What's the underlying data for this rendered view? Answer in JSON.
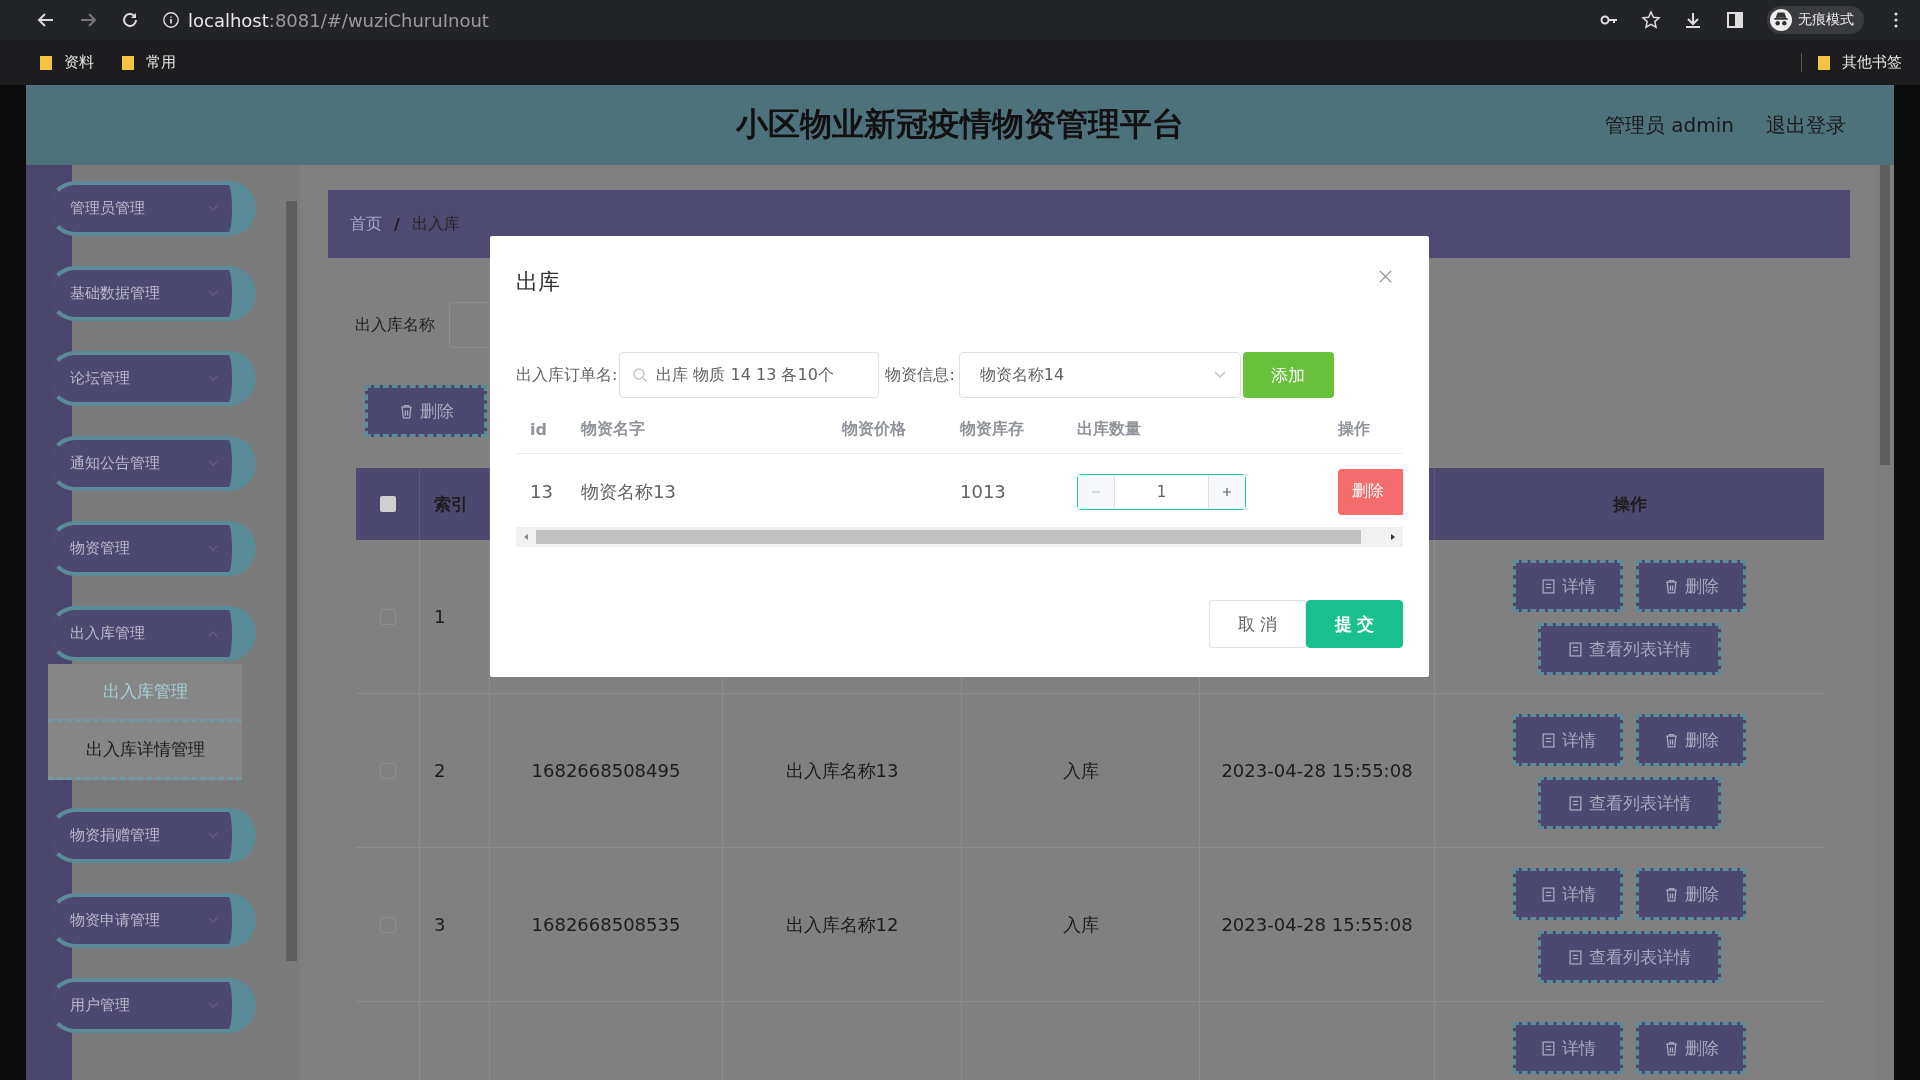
{
  "browser": {
    "url_host": "localhost",
    "url_path": ":8081/#/wuziChuruInout",
    "profile": "无痕模式",
    "bookmarks": [
      {
        "label": "资料"
      },
      {
        "label": "常用"
      }
    ],
    "other_bookmarks": "其他书签"
  },
  "header": {
    "title": "小区物业新冠疫情物资管理平台",
    "user": "管理员 admin",
    "logout": "退出登录"
  },
  "sidebar": {
    "items": [
      {
        "label": "管理员管理",
        "expanded": false
      },
      {
        "label": "基础数据管理",
        "expanded": false
      },
      {
        "label": "论坛管理",
        "expanded": false
      },
      {
        "label": "通知公告管理",
        "expanded": false
      },
      {
        "label": "物资管理",
        "expanded": false
      },
      {
        "label": "出入库管理",
        "expanded": true,
        "children": [
          {
            "label": "出入库管理",
            "selected": true
          },
          {
            "label": "出入库详情管理",
            "selected": false
          }
        ]
      },
      {
        "label": "物资捐赠管理",
        "expanded": false
      },
      {
        "label": "物资申请管理",
        "expanded": false
      },
      {
        "label": "用户管理",
        "expanded": false
      }
    ]
  },
  "breadcrumb": [
    "首页",
    "出入库"
  ],
  "breadcrumb_separator": "/",
  "search": {
    "label": "出入库名称"
  },
  "toolbar": {
    "delete": "删除"
  },
  "table": {
    "header_checked": false,
    "columns": [
      {
        "label": "索引"
      },
      {
        "label": "操作"
      }
    ],
    "rows": [
      {
        "index": "1",
        "checked": false,
        "actions": [
          "详情",
          "删除",
          "查看列表详情"
        ]
      },
      {
        "index": "2",
        "checked": false,
        "id": "1682668508495",
        "name": "出入库名称13",
        "type": "入库",
        "time": "2023-04-28 15:55:08",
        "actions": [
          "详情",
          "删除",
          "查看列表详情"
        ]
      },
      {
        "index": "3",
        "checked": false,
        "id": "1682668508535",
        "name": "出入库名称12",
        "type": "入库",
        "time": "2023-04-28 15:55:08",
        "actions": [
          "详情",
          "删除",
          "查看列表详情"
        ]
      },
      {
        "actions": [
          "详情",
          "删除"
        ]
      }
    ]
  },
  "modal": {
    "title": "出库",
    "order_label": "出入库订单名:",
    "order_value": "出库 物质 14 13 各10个",
    "material_label": "物资信息:",
    "material_value": "物资名称14",
    "add": "添加",
    "columns": [
      "id",
      "物资名字",
      "物资价格",
      "物资库存",
      "出库数量",
      "操作"
    ],
    "rows": [
      {
        "id": "13",
        "name": "物资名称13",
        "stock": "1013",
        "quantity": "1",
        "action": "删除"
      }
    ],
    "buttons": [
      {
        "label": "取 消",
        "kind": "cancel"
      },
      {
        "label": "提 交",
        "kind": "submit"
      }
    ]
  }
}
